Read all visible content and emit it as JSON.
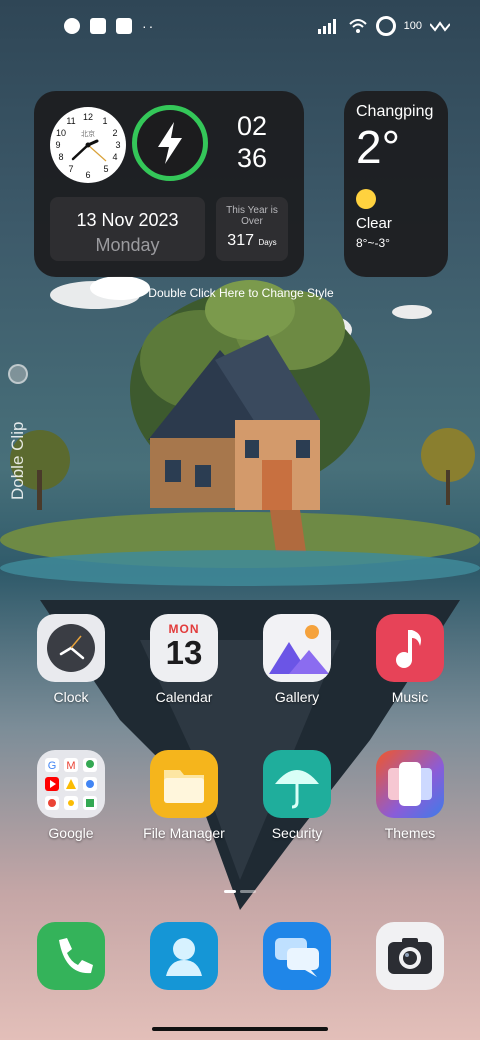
{
  "status_bar": {
    "battery_level": "100",
    "colors": {
      "icons": "#ffffff"
    }
  },
  "clock_widget": {
    "analog_city": "北京",
    "hour": "02",
    "minute": "36",
    "date": "13 Nov 2023",
    "weekday": "Monday",
    "year_label": "This Year is Over",
    "year_days": "317",
    "days_unit": "Days",
    "charging_color": "#34c759"
  },
  "weather_widget": {
    "city": "Changping",
    "temperature": "2°",
    "condition": "Clear",
    "range": "8°~-3°",
    "icon": "sun-icon"
  },
  "hint": "Double Click Here to Change Style",
  "side_panel": {
    "label": "Doble Clip"
  },
  "apps_row1": [
    {
      "label": "Clock",
      "icon": "clock-icon"
    },
    {
      "label": "Calendar",
      "icon": "calendar-icon",
      "month": "MON",
      "day": "13"
    },
    {
      "label": "Gallery",
      "icon": "gallery-icon"
    },
    {
      "label": "Music",
      "icon": "music-icon"
    }
  ],
  "apps_row2": [
    {
      "label": "Google",
      "icon": "google-folder-icon"
    },
    {
      "label": "File Manager",
      "icon": "folder-icon"
    },
    {
      "label": "Security",
      "icon": "umbrella-icon"
    },
    {
      "label": "Themes",
      "icon": "themes-icon"
    }
  ],
  "dock": [
    {
      "icon": "phone-icon",
      "color": "#34b35a"
    },
    {
      "icon": "contacts-icon",
      "color": "#1596d6"
    },
    {
      "icon": "messages-icon",
      "color": "#1f86e8"
    },
    {
      "icon": "camera-icon",
      "color": "#f1f1f3"
    }
  ]
}
